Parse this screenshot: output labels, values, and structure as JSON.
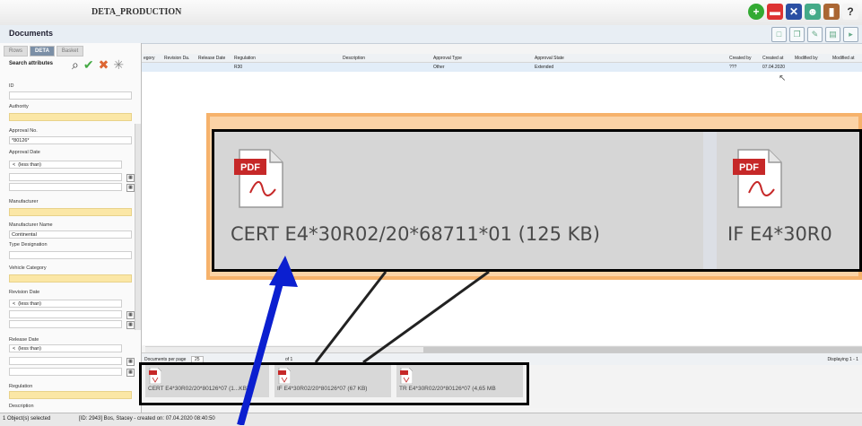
{
  "app": {
    "title": "DETA_PRODUCTION"
  },
  "docs_header": {
    "title": "Documents"
  },
  "tabs": [
    {
      "label": "Rows"
    },
    {
      "label": "DETA"
    },
    {
      "label": "Basket"
    }
  ],
  "search": {
    "title": "Search attributes",
    "fields": {
      "id_label": "ID",
      "authority_label": "Authority",
      "approval_no_label": "Approval No.",
      "approval_no_value": "*80126*",
      "approval_date_label": "Approval Date",
      "approval_date_op": "(less than)",
      "manufacturer_label": "Manufacturer",
      "manufacturer_name_label": "Manufacturer Name",
      "manufacturer_name_value": "Continental",
      "type_designation_label": "Type Designation",
      "vehicle_category_label": "Vehicle Category",
      "revision_date_label": "Revision Date",
      "revision_date_op": "(less than)",
      "release_date_label": "Release Date",
      "release_date_op": "(less than)",
      "regulation_label": "Regulation",
      "description_label": "Description"
    }
  },
  "grid": {
    "columns": [
      "egory",
      "Revision Da.",
      "Release Date",
      "Regulation",
      "Description",
      "Approval Type",
      "Approval State",
      "Created by",
      "Created at",
      "Modified by",
      "Modified at"
    ],
    "row": {
      "regulation": "R30",
      "approval_type": "Other",
      "approval_state": "Extended",
      "created_by": "???",
      "created_at": "07.04.2020"
    }
  },
  "pager": {
    "per_page_label": "Documents per page",
    "per_page_value": "25",
    "of_label": "of 1",
    "displaying": "Displaying 1 - 1"
  },
  "attachments": [
    {
      "name": "CERT E4*30R02/20*80126*07 (1...KB)"
    },
    {
      "name": "IF E4*30R02/20*80126*07 (67 KB)"
    },
    {
      "name": "TR E4*30R02/20*80126*07 (4,65 MB"
    }
  ],
  "zoom": {
    "item1": "CERT E4*30R02/20*68711*01 (125 KB)",
    "item2": "IF E4*30R0",
    "icon_label": "PDF"
  },
  "status": {
    "selected": "1 Object(s) selected",
    "info": "[ID: 2943] Bos, Stacey - created on: 07.04.2020 08:40:50"
  },
  "colors": {
    "highlight": "#f6b26b",
    "accent": "#7b8fa6",
    "arrow": "#0b1fd0"
  }
}
